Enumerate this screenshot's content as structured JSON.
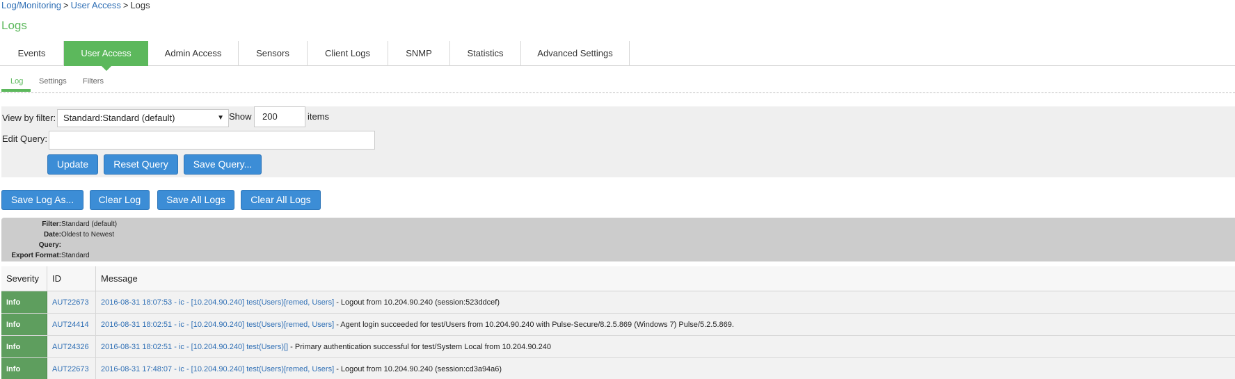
{
  "breadcrumb": {
    "part1": "Log/Monitoring",
    "sep1": ">",
    "part2": "User Access",
    "sep2": ">",
    "part3": "Logs"
  },
  "page_title": "Logs",
  "tabs": [
    {
      "label": "Events"
    },
    {
      "label": "User Access"
    },
    {
      "label": "Admin Access"
    },
    {
      "label": "Sensors"
    },
    {
      "label": "Client Logs"
    },
    {
      "label": "SNMP"
    },
    {
      "label": "Statistics"
    },
    {
      "label": "Advanced Settings"
    }
  ],
  "active_tab": "User Access",
  "subtabs": [
    {
      "label": "Log"
    },
    {
      "label": "Settings"
    },
    {
      "label": "Filters"
    }
  ],
  "query": {
    "view_by_filter_label": "View by filter:",
    "filter_selected": "Standard:Standard (default)",
    "show_label": "Show",
    "show_value": "200",
    "items_label": "items",
    "edit_query_label": "Edit Query:",
    "edit_query_value": "",
    "update_button": "Update",
    "reset_button": "Reset Query",
    "save_query_button": "Save Query..."
  },
  "log_actions": {
    "save_log_as": "Save Log As...",
    "clear_log": "Clear Log",
    "save_all_logs": "Save All Logs",
    "clear_all_logs": "Clear All Logs"
  },
  "summary": {
    "filter_key": "Filter:",
    "filter_value": "Standard (default)",
    "date_key": "Date:",
    "date_value": "Oldest to Newest",
    "query_key": "Query:",
    "query_value": "",
    "export_key": "Export Format:",
    "export_value": "Standard"
  },
  "table": {
    "headers": {
      "severity": "Severity",
      "id": "ID",
      "message": "Message"
    },
    "rows": [
      {
        "severity": "Info",
        "id": "AUT22673",
        "timestamp": "2016-08-31 18:07:53",
        "dash1": " - ",
        "node": "ic",
        "dash2": " - [",
        "ip": "10.204.90.240",
        "bracket_after_ip": "] ",
        "user": "test(Users)",
        "roles": "[remed, Users]",
        "text": " - Logout from 10.204.90.240 (session:523ddcef)"
      },
      {
        "severity": "Info",
        "id": "AUT24414",
        "timestamp": "2016-08-31 18:02:51",
        "dash1": " - ",
        "node": "ic",
        "dash2": " - [",
        "ip": "10.204.90.240",
        "bracket_after_ip": "] ",
        "user": "test(Users)",
        "roles": "[remed, Users]",
        "text": " - Agent login succeeded for test/Users from 10.204.90.240 with Pulse-Secure/8.2.5.869 (Windows 7) Pulse/5.2.5.869."
      },
      {
        "severity": "Info",
        "id": "AUT24326",
        "timestamp": "2016-08-31 18:02:51",
        "dash1": " - ",
        "node": "ic",
        "dash2": " - [",
        "ip": "10.204.90.240",
        "bracket_after_ip": "] ",
        "user": "test(Users)",
        "roles": "[]",
        "text": " - Primary authentication successful for test/System Local from 10.204.90.240"
      },
      {
        "severity": "Info",
        "id": "AUT22673",
        "timestamp": "2016-08-31 17:48:07",
        "dash1": " - ",
        "node": "ic",
        "dash2": " - [",
        "ip": "10.204.90.240",
        "bracket_after_ip": "] ",
        "user": "test(Users)",
        "roles": "[remed, Users]",
        "text": " - Logout from 10.204.90.240 (session:cd3a94a6)"
      }
    ]
  },
  "colors": {
    "accent_green": "#5cb85c",
    "button_blue": "#3c8dd6",
    "link_blue": "#2f6fb5",
    "severity_info": "#5e9e5e"
  }
}
